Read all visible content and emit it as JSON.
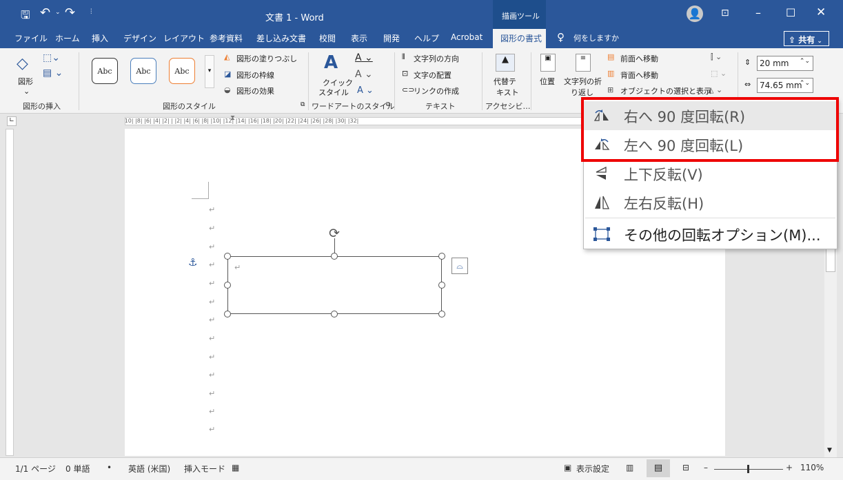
{
  "titlebar": {
    "title": "文書 1  -  Word",
    "context_tab": "描画ツール",
    "quick_access_more": "⫶"
  },
  "tabs": [
    "ファイル",
    "ホーム",
    "挿入",
    "デザイン",
    "レイアウト",
    "参考資料",
    "差し込み文書",
    "校閲",
    "表示",
    "開発",
    "ヘルプ",
    "Acrobat",
    "図形の書式"
  ],
  "tell_me": "何をしますか",
  "share": "共有",
  "ribbon": {
    "insert_shapes": {
      "label": "図形",
      "group": "図形の挿入"
    },
    "styles": {
      "samples": [
        "Abc",
        "Abc",
        "Abc"
      ],
      "fill": "図形の塗りつぶし",
      "outline": "図形の枠線",
      "effects": "図形の効果",
      "group": "図形のスタイル"
    },
    "wordart": {
      "quick_style": "クイック",
      "quick_style2": "スタイル",
      "group": "ワードアートのスタイル"
    },
    "text": {
      "direction": "文字列の方向",
      "align": "文字の配置",
      "link": "リンクの作成",
      "group": "テキスト"
    },
    "accessibility": {
      "alt1": "代替テ",
      "alt2": "キスト",
      "group": "アクセシビ…"
    },
    "arrange": {
      "position": "位置",
      "wrap1": "文字列の折",
      "wrap2": "り返し",
      "front": "前面へ移動",
      "back": "背面へ移動",
      "select": "オブジェクトの選択と表示"
    },
    "size": {
      "height": "20 mm",
      "width": "74.65 mm"
    }
  },
  "ruler_text": "|10| |8| |6| |4| |2| |  |2| |4| |6| |8| |10| |12| |14| |16| |18| |20| |22| |24| |26| |28| |30| |32|",
  "menu": {
    "items": [
      {
        "label": "右へ 90 度回転(R)",
        "icon": "rotate-right-icon"
      },
      {
        "label": "左へ 90 度回転(L)",
        "icon": "rotate-left-icon"
      },
      {
        "label": "上下反転(V)",
        "icon": "flip-vertical-icon"
      },
      {
        "label": "左右反転(H)",
        "icon": "flip-horizontal-icon"
      },
      {
        "label": "その他の回転オプション(M)...",
        "icon": "rotation-options-icon"
      }
    ]
  },
  "statusbar": {
    "page": "1/1 ページ",
    "words": "0 単語",
    "lang": "英語 (米国)",
    "mode": "挿入モード",
    "display": "表示設定",
    "zoom": "110%"
  },
  "colors": {
    "accent": "#2b579a",
    "highlight": "#e00000"
  }
}
